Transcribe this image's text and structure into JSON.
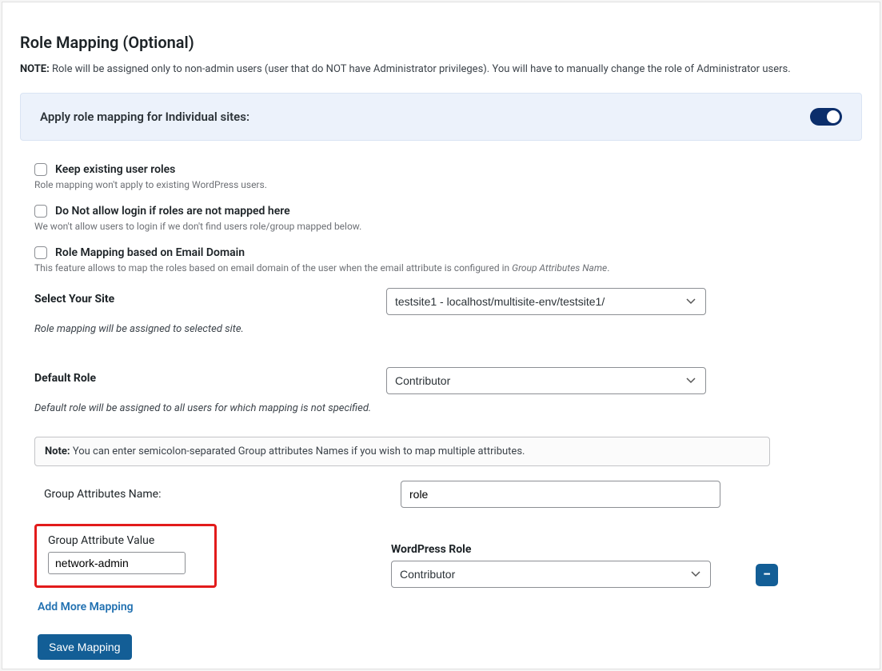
{
  "heading": "Role Mapping (Optional)",
  "note_label": "NOTE:",
  "note_text": "Role will be assigned only to non-admin users (user that do NOT have Administrator privileges). You will have to manually change the role of Administrator users.",
  "toggle": {
    "label": "Apply role mapping for Individual sites:"
  },
  "checkboxes": {
    "keep": {
      "label": "Keep existing user roles",
      "help": "Role mapping won't apply to existing WordPress users."
    },
    "nologin": {
      "label": "Do Not allow login if roles are not mapped here",
      "help": "We won't allow users to login if we don't find users role/group mapped below."
    },
    "emaildomain": {
      "label": "Role Mapping based on Email Domain",
      "help_pre": "This feature allows to map the roles based on email domain of the user when the email attribute is configured in ",
      "help_em": "Group Attributes Name",
      "help_post": "."
    }
  },
  "site": {
    "label": "Select Your Site",
    "value": "testsite1 - localhost/multisite-env/testsite1/",
    "help": "Role mapping will be assigned to selected site."
  },
  "default_role": {
    "label": "Default Role",
    "value": "Contributor",
    "help": "Default role will be assigned to all users for which mapping is not specified."
  },
  "note_box": {
    "label": "Note:",
    "text": "You can enter semicolon-separated Group attributes Names if you wish to map multiple attributes."
  },
  "ga_name": {
    "label": "Group Attributes Name:",
    "value": "role"
  },
  "mapping": {
    "gav_label": "Group Attribute Value",
    "gav_value": "network-admin",
    "wprole_label": "WordPress Role",
    "wprole_value": "Contributor",
    "remove_icon": "−"
  },
  "add_link": "Add More Mapping",
  "save_btn": "Save Mapping"
}
